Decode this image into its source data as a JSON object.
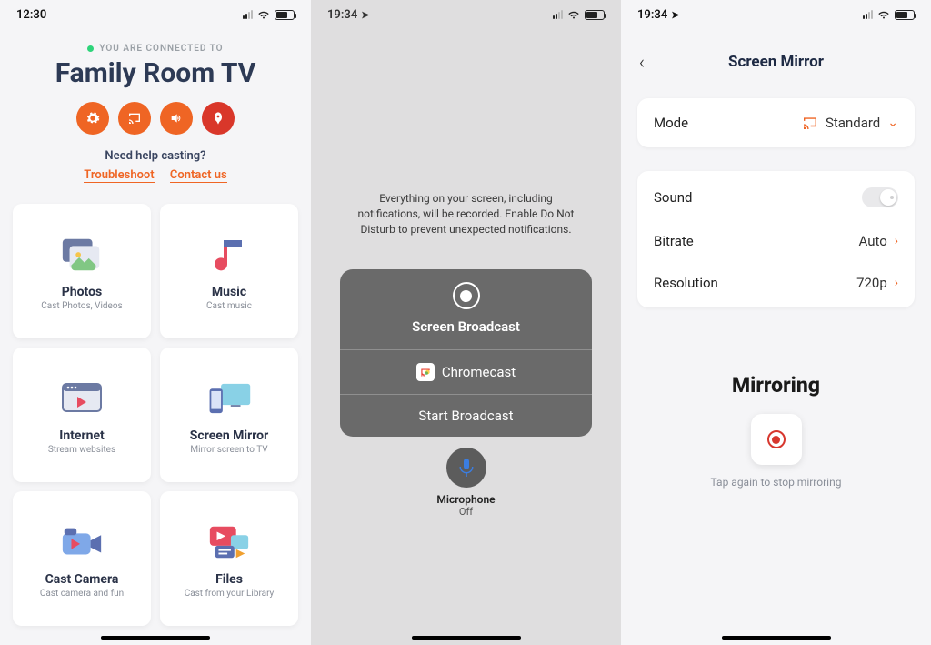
{
  "screen1": {
    "statusTime": "12:30",
    "connectedLabel": "YOU ARE CONNECTED TO",
    "deviceTitle": "Family Room TV",
    "helpQuestion": "Need help casting?",
    "troubleshoot": "Troubleshoot",
    "contact": "Contact us",
    "tiles": [
      {
        "title": "Photos",
        "sub": "Cast Photos, Videos"
      },
      {
        "title": "Music",
        "sub": "Cast music"
      },
      {
        "title": "Internet",
        "sub": "Stream websites"
      },
      {
        "title": "Screen Mirror",
        "sub": "Mirror screen to TV"
      },
      {
        "title": "Cast Camera",
        "sub": "Cast camera and fun"
      },
      {
        "title": "Files",
        "sub": "Cast from your Library"
      }
    ]
  },
  "screen2": {
    "statusTime": "19:34",
    "message": "Everything on your screen, including notifications, will be recorded. Enable Do Not Disturb to prevent unexpected notifications.",
    "panelTitle": "Screen Broadcast",
    "appName": "Chromecast",
    "startLabel": "Start Broadcast",
    "micLabel": "Microphone",
    "micState": "Off"
  },
  "screen3": {
    "statusTime": "19:34",
    "navTitle": "Screen Mirror",
    "modeLabel": "Mode",
    "modeValue": "Standard",
    "soundLabel": "Sound",
    "bitrateLabel": "Bitrate",
    "bitrateValue": "Auto",
    "resolutionLabel": "Resolution",
    "resolutionValue": "720p",
    "mirroringTitle": "Mirroring",
    "mirroringHint": "Tap again to stop mirroring"
  }
}
